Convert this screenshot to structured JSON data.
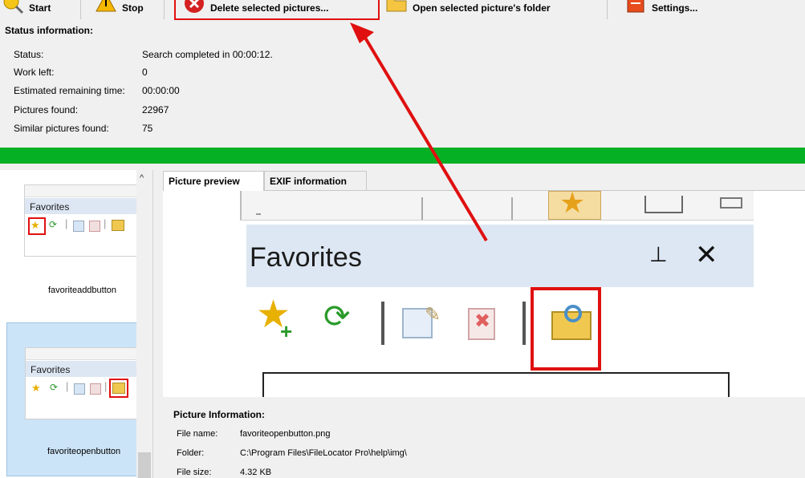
{
  "toolbar": {
    "start_label": "Start",
    "stop_label": "Stop",
    "delete_label": "Delete selected pictures...",
    "open_folder_label": "Open selected picture's folder",
    "settings_label": "Settings..."
  },
  "status": {
    "title": "Status information:",
    "rows": [
      {
        "label": "Status:",
        "value": "Search completed in 00:00:12."
      },
      {
        "label": "Work left:",
        "value": "0"
      },
      {
        "label": "Estimated remaining time:",
        "value": "00:00:00"
      },
      {
        "label": "Pictures found:",
        "value": "22967"
      },
      {
        "label": "Similar pictures found:",
        "value": "75"
      }
    ]
  },
  "progress": {
    "percent": 100,
    "color": "#06b025"
  },
  "list": {
    "items": [
      {
        "thumb_title": "Favorites",
        "caption": "favoriteaddbutton"
      },
      {
        "thumb_title": "Favorites",
        "caption": "favoriteopenbutton"
      }
    ]
  },
  "tabs": [
    {
      "label": "Picture preview"
    },
    {
      "label": "EXIF information"
    }
  ],
  "preview": {
    "title": "Favorites"
  },
  "info": {
    "title": "Picture Information:",
    "rows": [
      {
        "label": "File name:",
        "value": "favoriteopenbutton.png"
      },
      {
        "label": "Folder:",
        "value": "C:\\Program Files\\FileLocator Pro\\help\\img\\"
      },
      {
        "label": "File size:",
        "value": "4.32 KB"
      }
    ]
  },
  "colors": {
    "highlight": "#e01010",
    "accent": "#06b025"
  }
}
